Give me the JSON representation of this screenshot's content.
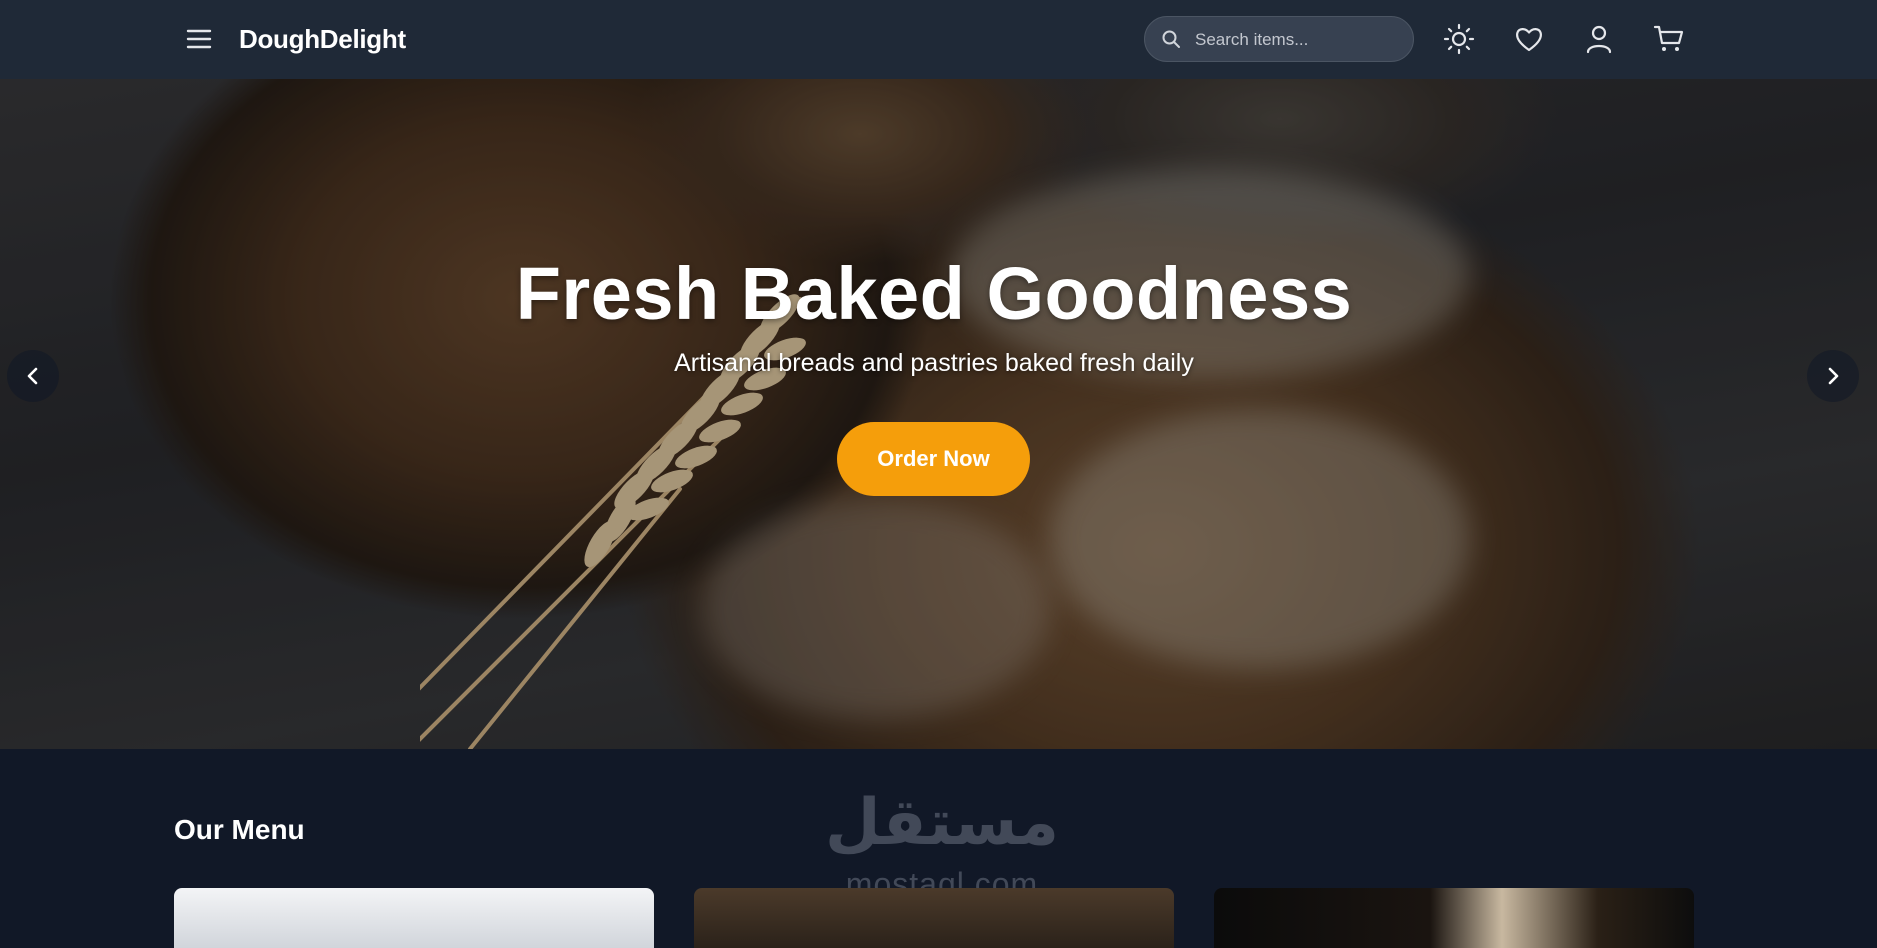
{
  "header": {
    "brand": "DoughDelight",
    "search_placeholder": "Search items...",
    "icons": [
      "menu-icon",
      "search-icon",
      "sun-icon",
      "heart-icon",
      "user-icon",
      "cart-icon"
    ]
  },
  "hero": {
    "title": "Fresh Baked Goodness",
    "subtitle": "Artisanal breads and pastries baked fresh daily",
    "cta_label": "Order Now",
    "prev_icon": "chevron-left-icon",
    "next_icon": "chevron-right-icon"
  },
  "menu": {
    "title": "Our Menu"
  },
  "watermark": {
    "arabic": "مستقل",
    "latin": "mostaql.com"
  },
  "colors": {
    "header_bg": "#1f2937",
    "page_bg": "#111827",
    "accent": "#f59e0b",
    "search_bg": "#374151"
  }
}
